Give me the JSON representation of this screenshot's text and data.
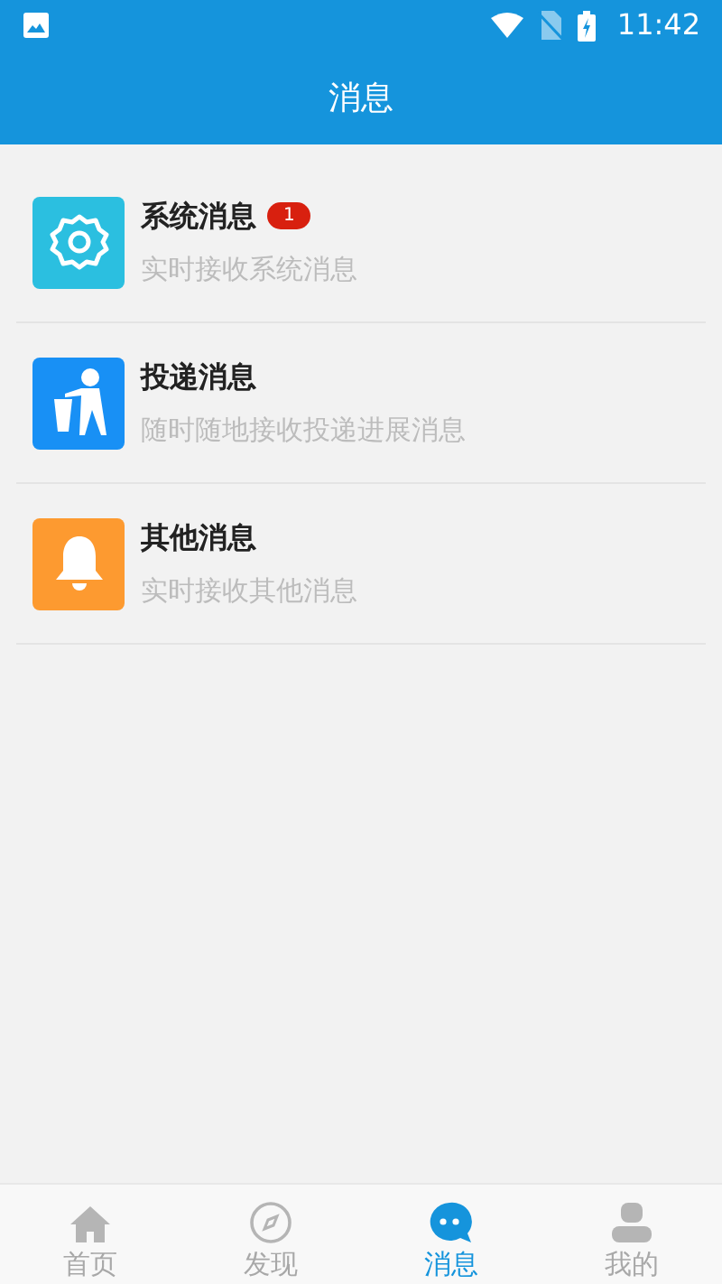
{
  "status_bar": {
    "time": "11:42"
  },
  "header": {
    "title": "消息"
  },
  "messages": [
    {
      "kind": "gear",
      "color": "#2bbfe0",
      "title": "系统消息",
      "badge": "1",
      "subtitle": "实时接收系统消息"
    },
    {
      "kind": "delivery",
      "color": "#1890f5",
      "title": "投递消息",
      "subtitle": "随时随地接收投递进展消息"
    },
    {
      "kind": "bell",
      "color": "#fd9a30",
      "title": "其他消息",
      "subtitle": "实时接收其他消息"
    }
  ],
  "tabs": [
    {
      "kind": "home",
      "label": "首页",
      "selected": false
    },
    {
      "kind": "compass",
      "label": "发现",
      "selected": false
    },
    {
      "kind": "chat",
      "label": "消息",
      "selected": true
    },
    {
      "kind": "user",
      "label": "我的",
      "selected": false
    }
  ]
}
